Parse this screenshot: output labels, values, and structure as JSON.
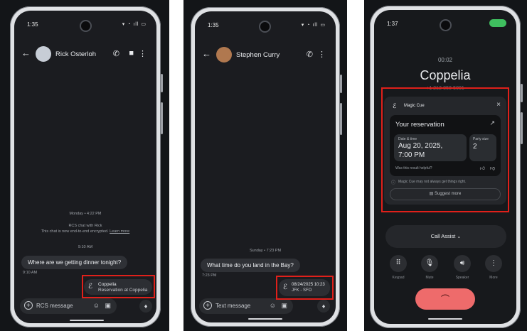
{
  "panel1": {
    "status_time": "1:35",
    "contact_name": "Rick Osterloh",
    "date_divider": "Monday • 4:22 PM",
    "rcs_line1": "RCS chat with Rick",
    "rcs_line2": "This chat is now end-to-end encrypted.",
    "rcs_learn_more": "Learn more",
    "time_divider": "9:10 AM",
    "incoming_message": "Where are we getting dinner tonight?",
    "incoming_time": "9:10 AM",
    "cue_line1": "Coppelia",
    "cue_line2": "Reservation at Coppelia",
    "composer_placeholder": "RCS message"
  },
  "panel2": {
    "status_time": "1:35",
    "contact_name": "Stephen Curry",
    "date_divider": "Sunday • 7:23 PM",
    "incoming_message": "What time do you land in the Bay?",
    "incoming_time": "7:23 PM",
    "cue_line1": "08/24/2025 10:23",
    "cue_line2": "JFK - SFO",
    "composer_placeholder": "Text message"
  },
  "panel3": {
    "status_time": "1:37",
    "call_timer": "00:02",
    "caller_name": "Coppelia",
    "caller_number": "+1 212-858-5001",
    "magic_cue_title": "Magic Cue",
    "reservation_title": "Your reservation",
    "date_label": "Date & time",
    "date_value_line1": "Aug 20, 2025,",
    "date_value_line2": "7:00 PM",
    "party_label": "Party size",
    "party_value": "2",
    "helpful_question": "Was this result helpful?",
    "disclaimer": "Magic Cue may not always get things right.",
    "suggest_more": "Suggest more",
    "call_assist": "Call Assist",
    "ctl_keypad": "Keypad",
    "ctl_mute": "Mute",
    "ctl_speaker": "Speaker",
    "ctl_more": "More"
  },
  "colors": {
    "highlight_box": "#e0201a",
    "screen_bg": "#1b1c20",
    "end_call": "#ee6b6b",
    "call_active_pill": "#3fbf5f"
  }
}
